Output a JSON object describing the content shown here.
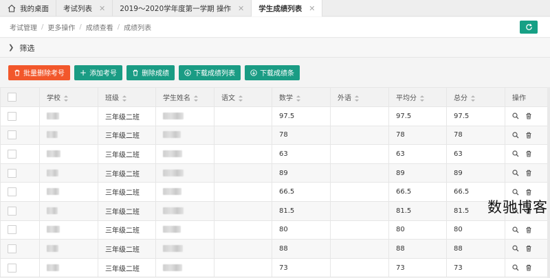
{
  "tabs": [
    {
      "label": "我的桌面",
      "closable": false,
      "active": false
    },
    {
      "label": "考试列表",
      "closable": true,
      "active": false
    },
    {
      "label": "2019～2020学年度第一学期 操作",
      "closable": true,
      "active": false
    },
    {
      "label": "学生成绩列表",
      "closable": true,
      "active": true
    }
  ],
  "breadcrumb": [
    "考试管理",
    "更多操作",
    "成绩查看",
    "成绩列表"
  ],
  "filter": {
    "label": "筛选"
  },
  "toolbar": {
    "batch_delete": "批量删除考号",
    "add_exam_no": "添加考号",
    "delete_scores": "删除成绩",
    "download_list": "下载成绩列表",
    "download_slip": "下载成绩条"
  },
  "table": {
    "headers": [
      "学校",
      "班级",
      "学生姓名",
      "语文",
      "数学",
      "外语",
      "平均分",
      "总分",
      "操作"
    ],
    "rows": [
      {
        "class": "三年级二班",
        "chinese": "",
        "math": "97.5",
        "english": "",
        "average": "97.5",
        "total": "97.5"
      },
      {
        "class": "三年级二班",
        "chinese": "",
        "math": "78",
        "english": "",
        "average": "78",
        "total": "78"
      },
      {
        "class": "三年级二班",
        "chinese": "",
        "math": "63",
        "english": "",
        "average": "63",
        "total": "63"
      },
      {
        "class": "三年级二班",
        "chinese": "",
        "math": "89",
        "english": "",
        "average": "89",
        "total": "89"
      },
      {
        "class": "三年级二班",
        "chinese": "",
        "math": "66.5",
        "english": "",
        "average": "66.5",
        "total": "66.5"
      },
      {
        "class": "三年级二班",
        "chinese": "",
        "math": "81.5",
        "english": "",
        "average": "81.5",
        "total": "81.5"
      },
      {
        "class": "三年级二班",
        "chinese": "",
        "math": "80",
        "english": "",
        "average": "80",
        "total": "80"
      },
      {
        "class": "三年级二班",
        "chinese": "",
        "math": "88",
        "english": "",
        "average": "88",
        "total": "88"
      },
      {
        "class": "三年级二班",
        "chinese": "",
        "math": "73",
        "english": "",
        "average": "73",
        "total": "73"
      }
    ]
  },
  "watermark": "数驰博客",
  "colors": {
    "accent_green": "#1a9c84",
    "danger": "#f2572b",
    "refresh": "#16a085"
  }
}
